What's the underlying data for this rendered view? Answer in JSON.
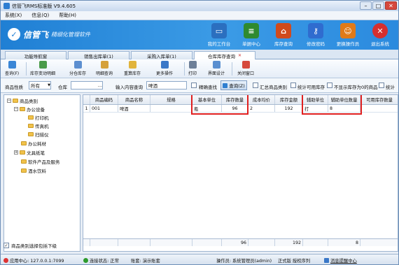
{
  "window": {
    "title": "信管飞RMS标准版 V9.4.605"
  },
  "menu": [
    "系统(X)",
    "信息(Q)",
    "帮助(H)"
  ],
  "brand": {
    "name": "信管飞",
    "slogan": "精细化管理软件"
  },
  "banner_tools": [
    {
      "label": "我的工作台",
      "color": "#2b6fbf"
    },
    {
      "label": "单据中心",
      "color": "#2f8a2f"
    },
    {
      "label": "库存查询",
      "color": "#d04a1d"
    },
    {
      "label": "修改密码",
      "color": "#2f6ccf"
    },
    {
      "label": "更换操作员",
      "color": "#e07a18"
    },
    {
      "label": "退出系统",
      "color": "#d62f2f"
    }
  ],
  "tabs": [
    "功能导航窗",
    "销售出库单(1)",
    "采购入库单(1)",
    "仓库库存查询"
  ],
  "toolbar": [
    "查询(F)",
    "库存变动明细",
    "分仓库存",
    "明细查询",
    "重算库存",
    "更多操作",
    "打印",
    "界面设计",
    "关闭窗口"
  ],
  "filter": {
    "category_label": "商品性质",
    "category_value": "所有",
    "warehouse_label": "仓库",
    "warehouse_value": "",
    "ellipsis": "...",
    "keyword_label": "输入内容查询",
    "keyword_value": "啤酒",
    "fuzzy_label": "精确查找",
    "query_button": "查询(Z)",
    "summary_label": "汇总商品类别",
    "available_label": "统计可用库存",
    "zero_label": "不显示库存为0的商品",
    "stat_label": "统计"
  },
  "tree": {
    "root": "商品类别",
    "nodes": [
      "办公设备",
      "打印机",
      "传真机",
      "扫描仪",
      "办公耗材",
      "文具纸笔",
      "软件产品及服务",
      "酒水饮料"
    ],
    "footer_checkbox": "商品类别选择包括下级"
  },
  "grid": {
    "columns": [
      "",
      "商品编码",
      "商品名称",
      "规格",
      "基本单位",
      "库存数量",
      "成本均价",
      "库存金额",
      "辅助单位",
      "辅助单位数量",
      "可用库存数量"
    ],
    "rows": [
      [
        "1",
        "001",
        "啤酒",
        "",
        "瓶",
        "96",
        "2",
        "192",
        "打",
        "8",
        ""
      ]
    ],
    "footer": [
      "",
      "",
      "",
      "",
      "",
      "96",
      "",
      "192",
      "",
      "8",
      ""
    ]
  },
  "status": {
    "app_center": "应用中心: 127.0.0.1:7099",
    "connection": "连接状态: 正常",
    "account": "账套: 演示账套",
    "operator": "操作员: 系统管理员(admin)",
    "edition": "正式版 授权序列",
    "messages": "消息提醒中心"
  },
  "colors": {
    "banner": "#2b8ade",
    "highlight": "#e02020",
    "accent": "#1f7fd4"
  }
}
